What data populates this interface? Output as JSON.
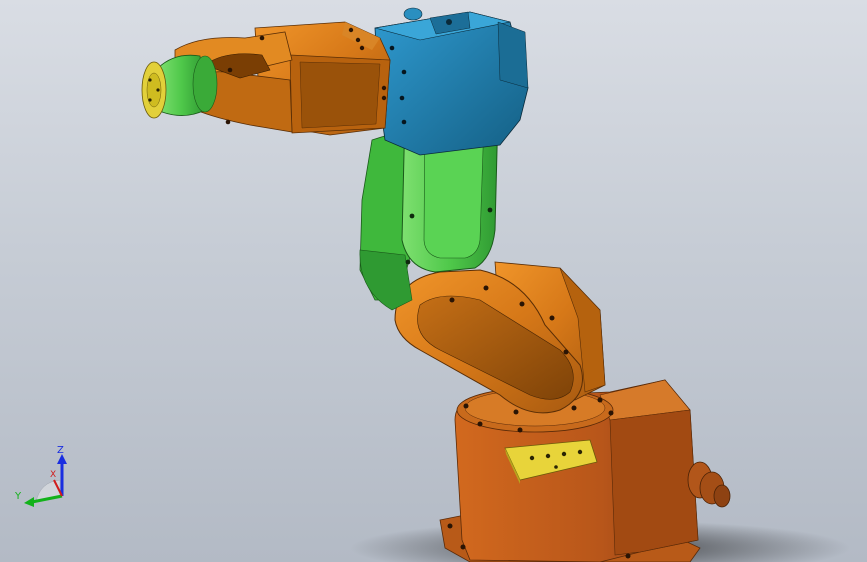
{
  "viewport": {
    "background_top": "#d9dde4",
    "background_bottom": "#b3bac5"
  },
  "model": {
    "parts": [
      {
        "name": "base",
        "color": "#c8641c"
      },
      {
        "name": "base-connector-plate",
        "color": "#e6d23a"
      },
      {
        "name": "cable-gland",
        "color": "#b8581a"
      },
      {
        "name": "lower-arm-link",
        "color": "#d87a1e"
      },
      {
        "name": "upper-arm-link",
        "color": "#4fc84a"
      },
      {
        "name": "elbow-housing",
        "color": "#1f7fa8"
      },
      {
        "name": "forearm-link",
        "color": "#d87a1e"
      },
      {
        "name": "wrist-flange",
        "color": "#4fc84a"
      }
    ]
  },
  "triad": {
    "z_label": "Z",
    "x_label": "X",
    "y_label": "Y",
    "z_color": "#1a2ee0",
    "x_color": "#d01c1c",
    "y_color": "#12b21a"
  }
}
